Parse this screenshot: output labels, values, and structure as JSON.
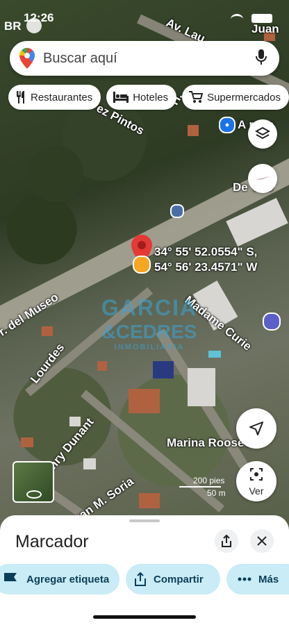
{
  "status_bar": {
    "carrier": "BR",
    "time": "12:26"
  },
  "search": {
    "placeholder": "Buscar aquí"
  },
  "chips": [
    {
      "label": "Restaurantes",
      "icon": "fork-knife-icon"
    },
    {
      "label": "Hoteles",
      "icon": "bed-icon"
    },
    {
      "label": "Supermercados",
      "icon": "cart-icon"
    }
  ],
  "map": {
    "streets": {
      "av_la": "Av. Lau",
      "juan": "Juan",
      "perez_pintos": "ez Pintos",
      "h_label": "H.",
      "arroyo": "A roya",
      "de_vito": "De Vito",
      "del_museo": "r. del Museo",
      "lourdes": "Lourdes",
      "madame_curie": "Madame Curie",
      "henry_dunant": "Henry Dunant",
      "marina_roosevelt": "Marina Roosev",
      "juan_m_soria": "Juan M. Soria"
    },
    "coordinates": {
      "lat": "34° 55' 52.0554\" S,",
      "lng": "54° 56' 23.4571\" W"
    },
    "watermark": {
      "line1": "GARCIA",
      "line2": "&CEDRES",
      "line3": "INMOBILIARIA"
    },
    "scale": {
      "top": "200 pies",
      "bottom": "50 m"
    },
    "ver_label": "Ver"
  },
  "sheet": {
    "title": "Marcador",
    "actions": [
      {
        "label": "Agregar etiqueta",
        "icon": "flag-icon"
      },
      {
        "label": "Compartir",
        "icon": "share-icon"
      },
      {
        "label": "Más",
        "icon": "more-icon"
      }
    ]
  },
  "colors": {
    "pin": "#e53935",
    "accent": "#0b57d0",
    "chip_action_bg": "#c9ecf7"
  }
}
